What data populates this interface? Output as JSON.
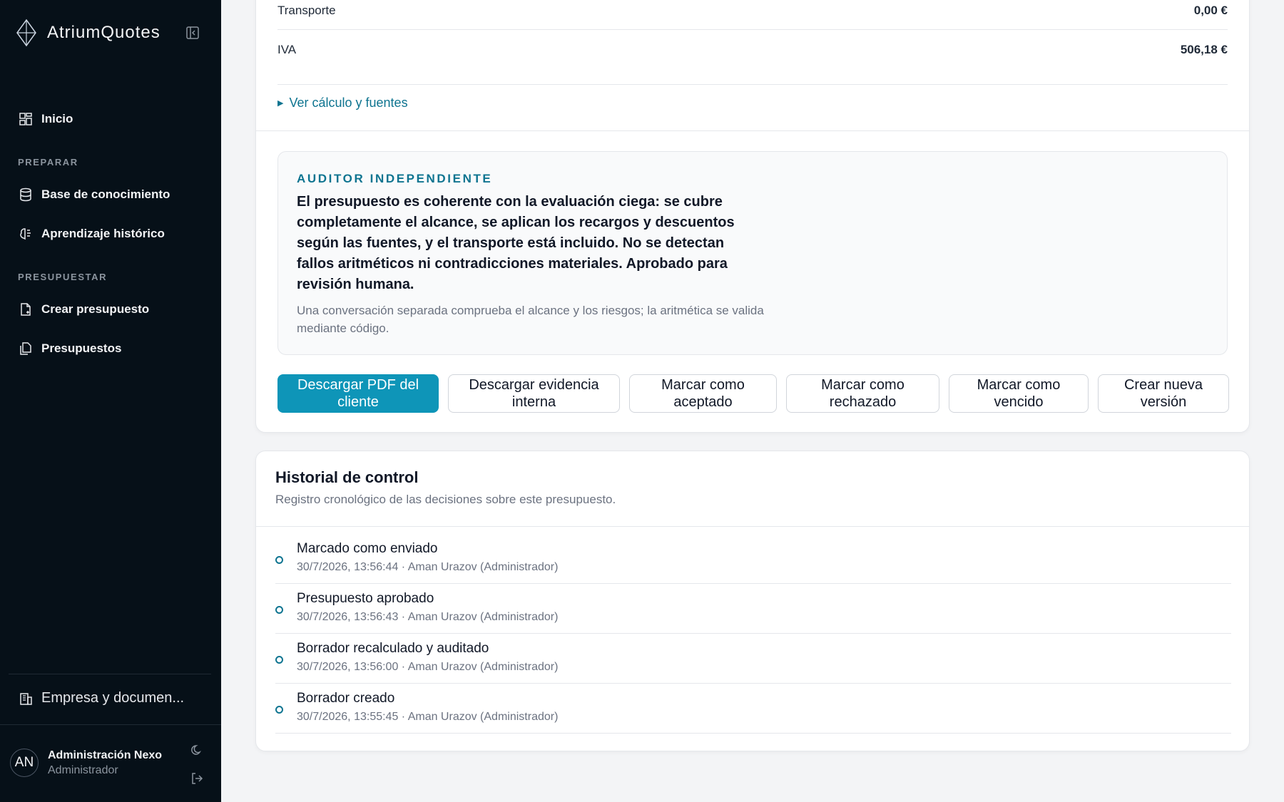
{
  "app": {
    "name": "AtriumQuotes"
  },
  "sidebar": {
    "home": "Inicio",
    "sections": {
      "prepare": "PREPARAR",
      "budget": "PRESUPUESTAR"
    },
    "items": {
      "knowledge": "Base de conocimiento",
      "history": "Aprendizaje histórico",
      "create": "Crear presupuesto",
      "quotes": "Presupuestos"
    },
    "company": "Empresa y documen...",
    "user": {
      "initials": "AN",
      "name": "Administración Nexo",
      "role": "Administrador"
    }
  },
  "summary": {
    "rows": [
      {
        "label": "Transporte",
        "value": "0,00 €"
      },
      {
        "label": "IVA",
        "value": "506,18 €"
      }
    ],
    "details_link": "Ver cálculo y fuentes"
  },
  "auditor": {
    "label": "AUDITOR INDEPENDIENTE",
    "verdict": "El presupuesto es coherente con la evaluación ciega: se cubre completamente el alcance, se aplican los recargos y descuentos según las fuentes, y el transporte está incluido. No se detectan fallos aritméticos ni contradicciones materiales. Aprobado para revisión humana.",
    "note": "Una conversación separada comprueba el alcance y los riesgos; la aritmética se valida mediante código."
  },
  "actions": {
    "download_pdf": "Descargar PDF del cliente",
    "download_evidence": "Descargar evidencia interna",
    "mark_accepted": "Marcar como aceptado",
    "mark_rejected": "Marcar como rechazado",
    "mark_expired": "Marcar como vencido",
    "new_version": "Crear nueva versión"
  },
  "history": {
    "title": "Historial de control",
    "subtitle": "Registro cronológico de las decisiones sobre este presupuesto.",
    "events": [
      {
        "title": "Marcado como enviado",
        "meta": "30/7/2026, 13:56:44 · Aman Urazov (Administrador)"
      },
      {
        "title": "Presupuesto aprobado",
        "meta": "30/7/2026, 13:56:43 · Aman Urazov (Administrador)"
      },
      {
        "title": "Borrador recalculado y auditado",
        "meta": "30/7/2026, 13:56:00 · Aman Urazov (Administrador)"
      },
      {
        "title": "Borrador creado",
        "meta": "30/7/2026, 13:55:45 · Aman Urazov (Administrador)"
      }
    ]
  },
  "colors": {
    "accent": "#0e95b8",
    "accent_text": "#0e7490",
    "sidebar_bg": "#061018"
  }
}
